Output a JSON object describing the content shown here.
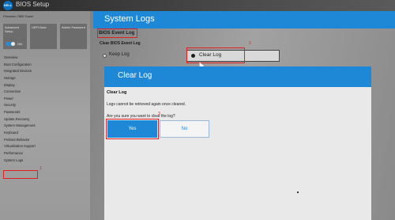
{
  "app": {
    "logo": "DELL",
    "title": "BIOS Setup",
    "model": "Precision 7865 Tower"
  },
  "tiles": {
    "advanced": {
      "label": "Advanced Setup",
      "toggle_label": "ON"
    },
    "uefi": {
      "label": "UEFI Boot"
    },
    "admin": {
      "label": "Admin Password"
    }
  },
  "sidebar": {
    "items": [
      {
        "label": "Overview"
      },
      {
        "label": "Boot Configuration"
      },
      {
        "label": "Integrated Devices"
      },
      {
        "label": "Storage"
      },
      {
        "label": "Display"
      },
      {
        "label": "Connection"
      },
      {
        "label": "Power"
      },
      {
        "label": "Security"
      },
      {
        "label": "Passwords"
      },
      {
        "label": "Update,Recovery"
      },
      {
        "label": "System Management"
      },
      {
        "label": "Keyboard"
      },
      {
        "label": "Preboot Behavior"
      },
      {
        "label": "Virtualization Support"
      },
      {
        "label": "Performance"
      },
      {
        "label": "System Logs"
      }
    ],
    "selected": "System Logs"
  },
  "page": {
    "title": "System Logs",
    "section": "BIOS Event Log",
    "subsection": "Clear BIOS Event Log",
    "options": {
      "keep": "Keep Log",
      "clear": "Clear Log"
    },
    "selected_option": "Clear Log"
  },
  "dialog": {
    "title": "Clear Log",
    "heading": "Clear Log",
    "warning": "Logs cannot be retrieved again once cleared.",
    "question": "Are you sure you want to clear the log?",
    "yes_label": "Yes",
    "no_label": "No"
  },
  "annotations": {
    "step1": "1",
    "step2": "2",
    "step3": "3",
    "color": "#e02020"
  },
  "colors": {
    "accent": "#1e88d6"
  }
}
